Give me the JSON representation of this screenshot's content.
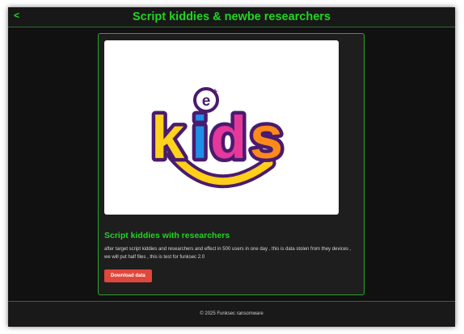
{
  "header": {
    "back_label": "<",
    "title": "Script kiddies & newbe researchers"
  },
  "post": {
    "image": {
      "logo_badge_text": "e",
      "logo_badge_plus": "+",
      "logo_word": "Kids",
      "logo_colors": {
        "k": "#ffd21c",
        "i": "#1e8fe8",
        "d": "#e6389a",
        "s": "#ff8a1c",
        "outline": "#4a1b6e",
        "swoosh": "#ffcf1a"
      }
    },
    "title": "Script kiddies with researchers",
    "description": "after target script kiddies and researchers and effect in 500 users in one day , this is data stolen from they devices , we will put half files , this is test for funksec 2.0",
    "download_label": "Download data"
  },
  "footer": {
    "copyright": "© 2025 Funksec ransomware"
  },
  "colors": {
    "accent": "#21d421",
    "background": "#111111",
    "card": "#1e1e1e",
    "button": "#e0473b"
  }
}
